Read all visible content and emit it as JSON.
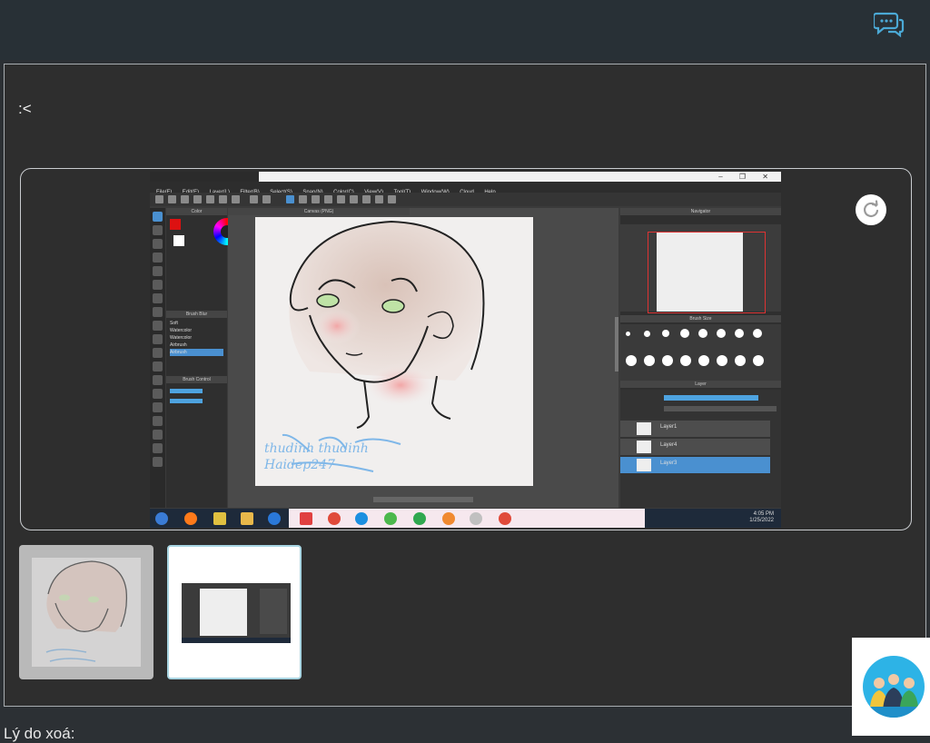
{
  "comment": {
    "text": ":<"
  },
  "footer": {
    "reason_label": "Lý do xoá:"
  },
  "screenshot": {
    "menu": [
      "File(F)",
      "Edit(E)",
      "Layer(L)",
      "Filter(B)",
      "Select(S)",
      "Snap(N)",
      "Color(C)",
      "View(V)",
      "Tool(T)",
      "Window(W)",
      "Cloud",
      "Help"
    ],
    "left_panel_headers": [
      "Color",
      "Brush Blur",
      "Brush Control"
    ],
    "brush_list": [
      "Soft",
      "Watercolor",
      "Watercolor",
      "Airbrush",
      "Airbrush"
    ],
    "canvas_tab": "Canvas (PNG)",
    "right_panel_headers": [
      "Navigator",
      "Brush Size",
      "Layer"
    ],
    "layers": [
      "Layer1",
      "Layer4",
      "Layer3"
    ],
    "signature": "thudinh thudinh Haidep247",
    "clock": {
      "time": "4:05 PM",
      "date": "1/25/2022"
    }
  },
  "colors": {
    "accent": "#4ba9d6",
    "background": "#2c3034",
    "panel": "#2e2e2e"
  },
  "icons": {
    "chat": "chat-bubbles-icon",
    "rotate": "rotate-icon"
  }
}
